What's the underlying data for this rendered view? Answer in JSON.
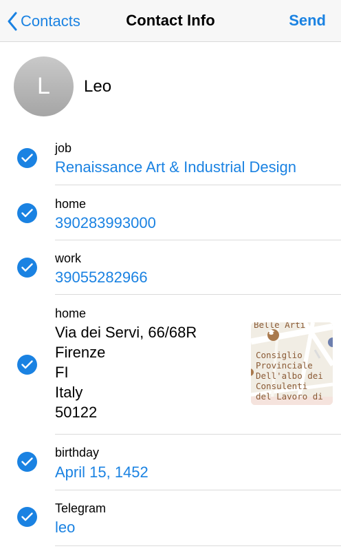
{
  "navbar": {
    "back_label": "Contacts",
    "title": "Contact Info",
    "send_label": "Send"
  },
  "contact": {
    "avatar_initial": "L",
    "name": "Leo"
  },
  "fields": {
    "job": {
      "label": "job",
      "value": "Renaissance Art & Industrial Design",
      "checked": true
    },
    "home_phone": {
      "label": "home",
      "value": "390283993000",
      "checked": true
    },
    "work_phone": {
      "label": "work",
      "value": "39055282966",
      "checked": true
    },
    "home_address": {
      "label": "home",
      "lines": [
        "Via dei Servi, 66/68R",
        "Firenze",
        "FI",
        "Italy",
        "50122"
      ],
      "checked": true
    },
    "birthday": {
      "label": "birthday",
      "value": "April 15, 1452",
      "checked": true
    },
    "telegram": {
      "label": "Telegram",
      "value": "leo",
      "checked": true
    }
  },
  "map": {
    "top_label": "Belle Arti",
    "place_lines": [
      "Consiglio",
      "Provinciale",
      "Dell'albo dei",
      "Consulenti",
      "del Lavoro di"
    ]
  },
  "colors": {
    "accent": "#1a82e2",
    "separator": "#dadada",
    "navbar_bg": "#f7f7f7",
    "avatar_gray": "#b3b3b3"
  },
  "icons": {
    "back": "chevron-left-icon",
    "check": "checkmark-icon"
  }
}
